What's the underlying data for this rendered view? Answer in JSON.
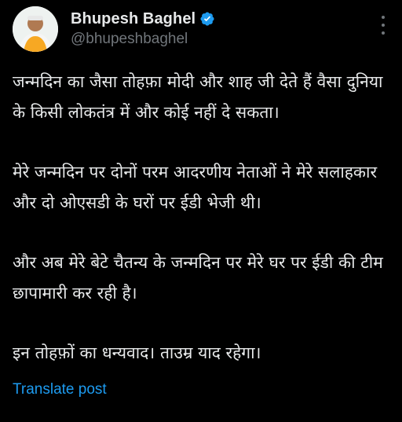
{
  "post": {
    "author": {
      "display_name": "Bhupesh Baghel",
      "handle": "@bhupeshbaghel",
      "verified": true
    },
    "paragraphs": [
      "जन्मदिन का जैसा तोहफ़ा मोदी और शाह जी देते हैं वैसा दुनिया के किसी लोकतंत्र में और कोई नहीं दे सकता।",
      "मेरे जन्मदिन पर दोनों परम आदरणीय नेताओं ने मेरे सलाहकार और दो ओएसडी के घरों पर ईडी भेजी थी।",
      "और अब मेरे बेटे चैतन्य के जन्मदिन पर मेरे घर पर ईडी की टीम छापामारी कर रही है।",
      "इन तोहफ़ों का धन्यवाद। ताउम्र याद रहेगा।"
    ],
    "translate_label": "Translate post"
  },
  "colors": {
    "background": "#000000",
    "text": "#e7e9ea",
    "secondary_text": "#71767b",
    "link": "#1d9bf0",
    "verified_badge": "#1d9bf0"
  },
  "icons": {
    "verified": "verified-badge-icon",
    "more": "more-options-icon"
  }
}
